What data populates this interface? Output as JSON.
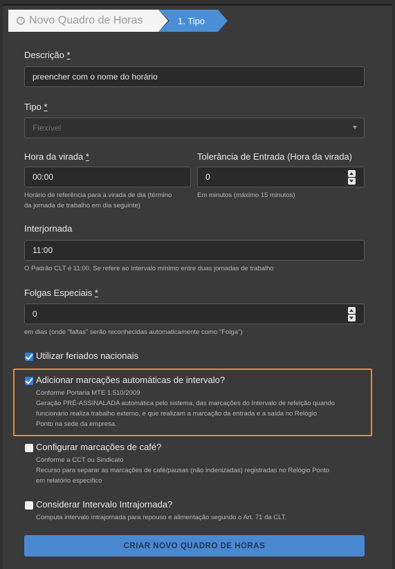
{
  "breadcrumb": {
    "title": "Novo Quadro de Horas",
    "step": "1. Tipo",
    "title_icon": "clock-icon"
  },
  "descricao": {
    "label": "Descrição",
    "value": "preencher com o nome do horário"
  },
  "tipo": {
    "label": "Tipo",
    "value": "Flexível"
  },
  "hora_virada": {
    "label": "Hora da virada",
    "value": "00:00",
    "help_line1": "Horário de referência para a virada de dia (término",
    "help_line2": "da jornada de trabalho em dia seguinte)"
  },
  "tolerancia": {
    "label": "Tolerância de Entrada (Hora da virada)",
    "value": "0",
    "help": "Em minutos (máximo 15 minutos)"
  },
  "interjornada": {
    "label": "Interjornada",
    "value": "11:00",
    "help": "O Padrão CLT é 11:00. Se refere ao intervalo mínimo entre duas jornadas de trabalho"
  },
  "folgas": {
    "label": "Folgas Especiais",
    "value": "0",
    "help": "em dias (onde \"faltas\" serão reconhecidas automaticamente como \"Folga\")"
  },
  "required_mark": "*",
  "feriados": {
    "label": "Utilizar feriados nacionais",
    "checked": true
  },
  "intervalo": {
    "label": "Adicionar marcações automáticas de intervalo?",
    "checked": true,
    "line1": "Conforme Portaria MTE 1.510/2009",
    "line2": "Geração PRÉ-ASSINALADA automática pelo sistema, das marcações do Intervalo de refeição quando",
    "line3": "funcionário realiza trabalho externo, e que realizam a marcação da entrada e a saída no Relógio",
    "line4": "Ponto na sede da empresa."
  },
  "cafe": {
    "label": "Configurar marcações de café?",
    "checked": false,
    "line1": "Conforme a CCT ou Sindicato",
    "line2": "Recurso para separar as marcações de café/pausas (não indenizadas) registradas no Relógio Ponto",
    "line3": "em relatório específico"
  },
  "intrajornada": {
    "label": "Considerar Intervalo Intrajornada?",
    "checked": false,
    "line1": "Computa intervalo intrajornada para repouso e alimentação segundo o Art. 71 da CLT."
  },
  "submit": {
    "label": "CRIAR NOVO QUADRO DE HORAS"
  },
  "colors": {
    "accent": "#4a8fd6",
    "highlight": "#f08a24",
    "background": "#3a3a3a"
  }
}
